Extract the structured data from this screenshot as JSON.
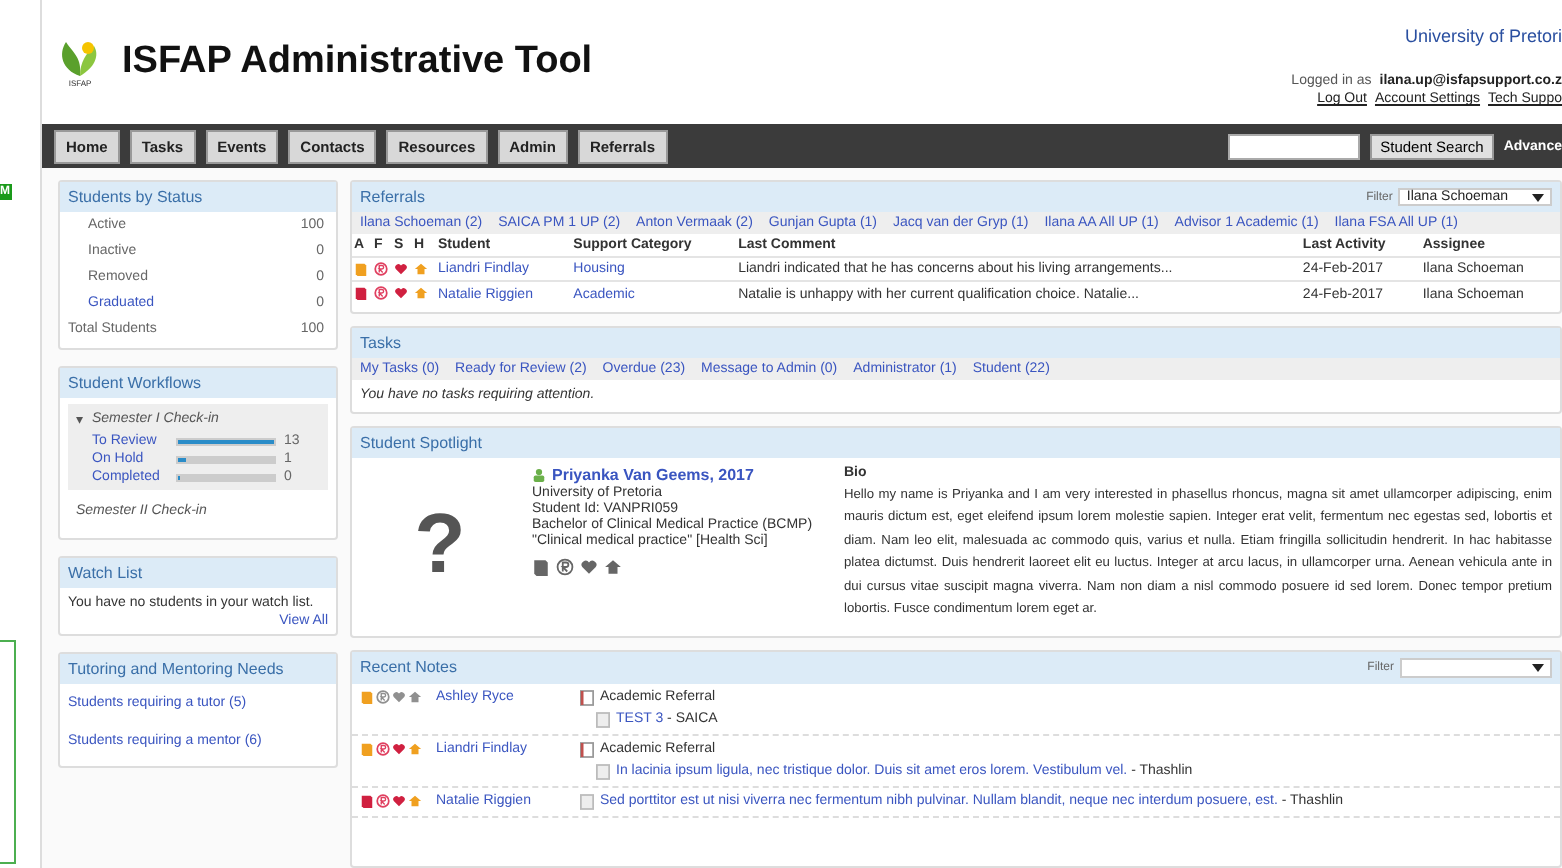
{
  "edge": {
    "badge": "M"
  },
  "header": {
    "logo_caption": "ISFAP",
    "title": "ISFAP Administrative Tool",
    "university": "University of Pretori",
    "logged_in_label": "Logged in as",
    "user": "ilana.up@isfapsupport.co.z",
    "links": [
      "Log Out",
      "Account Settings",
      "Tech Suppo"
    ]
  },
  "nav": {
    "tabs": [
      "Home",
      "Tasks",
      "Events",
      "Contacts",
      "Resources",
      "Admin",
      "Referrals"
    ],
    "search_button": "Student Search",
    "advanced": "Advance"
  },
  "students_by_status": {
    "title": "Students by Status",
    "rows": [
      {
        "label": "Active",
        "count": "100",
        "link": false
      },
      {
        "label": "Inactive",
        "count": "0",
        "link": false
      },
      {
        "label": "Removed",
        "count": "0",
        "link": false
      },
      {
        "label": "Graduated",
        "count": "0",
        "link": true
      }
    ],
    "total_label": "Total Students",
    "total": "100"
  },
  "workflows": {
    "title": "Student Workflows",
    "groups": [
      {
        "label": "Semester I Check-in",
        "expanded": true,
        "glyph": "▾",
        "items": [
          {
            "label": "To Review",
            "level": 1.0,
            "count": "13"
          },
          {
            "label": "On Hold",
            "level": 0.08,
            "count": "1"
          },
          {
            "label": "Completed",
            "level": 0,
            "count": "0"
          }
        ]
      },
      {
        "label": "Semester II Check-in",
        "expanded": false
      }
    ]
  },
  "watch_list": {
    "title": "Watch List",
    "message": "You have no students in your watch list.",
    "view_all": "View All"
  },
  "tutoring": {
    "title": "Tutoring and Mentoring Needs",
    "links": [
      "Students requiring a tutor (5)",
      "Students requiring a mentor (6)"
    ]
  },
  "referrals": {
    "title": "Referrals",
    "filter_label": "Filter",
    "filter_value": "Ilana Schoeman",
    "tabs": [
      "Ilana Schoeman (2)",
      "SAICA PM 1 UP (2)",
      "Anton Vermaak (2)",
      "Gunjan Gupta (1)",
      "Jacq van der Gryp (1)",
      "Ilana AA All UP (1)",
      "Advisor 1 Academic (1)",
      "Ilana FSA All UP (1)"
    ],
    "columns": [
      "A",
      "F",
      "S",
      "H",
      "Student",
      "Support Category",
      "Last Comment",
      "Last Activity",
      "Assignee"
    ],
    "rows": [
      {
        "icons": [
          {
            "kind": "book",
            "color": "#f0a020"
          },
          {
            "kind": "r",
            "color": "#e04060"
          },
          {
            "kind": "heart",
            "color": "#d02040"
          },
          {
            "kind": "home",
            "color": "#f0a020"
          }
        ],
        "student": "Liandri Findlay",
        "category": "Housing",
        "comment": "Liandri indicated that he has concerns about his living arrangements...",
        "date": "24-Feb-2017",
        "assignee": "Ilana Schoeman"
      },
      {
        "icons": [
          {
            "kind": "book",
            "color": "#d02040"
          },
          {
            "kind": "r",
            "color": "#e04060"
          },
          {
            "kind": "heart",
            "color": "#d02040"
          },
          {
            "kind": "home",
            "color": "#f0a020"
          }
        ],
        "student": "Natalie Riggien",
        "category": "Academic",
        "comment": "Natalie is unhappy with her current qualification choice. Natalie...",
        "date": "24-Feb-2017",
        "assignee": "Ilana Schoeman"
      }
    ]
  },
  "tasks": {
    "title": "Tasks",
    "tabs": [
      "My Tasks (0)",
      "Ready for Review (2)",
      "Overdue (23)",
      "Message to Admin (0)",
      "Administrator (1)",
      "Student (22)"
    ],
    "message": "You have no tasks requiring attention."
  },
  "spotlight": {
    "title": "Student Spotlight",
    "avatar_glyph": "?",
    "name": "Priyanka Van Geems, 2017",
    "lines": [
      "University of Pretoria",
      "Student Id: VANPRI059",
      "Bachelor of Clinical Medical Practice (BCMP)",
      "\"Clinical medical practice\" [Health Sci]"
    ],
    "bio_label": "Bio",
    "bio": "Hello my name is Priyanka and I am very interested in phasellus rhoncus, magna sit amet ullamcorper adipiscing, enim mauris dictum est, eget eleifend ipsum lorem molestie sapien. Integer erat velit, fermentum nec egestas sed, lobortis et diam. Nam leo elit, malesuada ac commodo quis, varius et nulla. Etiam fringilla sollicitudin hendrerit. In hac habitasse platea dictumst. Duis hendrerit laoreet elit eu luctus. Integer at arcu lacus, in ullamcorper urna. Aenean vehicula ante in dui cursus vitae suscipit magna viverra. Nam non diam a nisl commodo posuere id sed lorem. Donec tempor pretium lobortis. Fusce condimentum lorem eget ar."
  },
  "recent_notes": {
    "title": "Recent Notes",
    "filter_label": "Filter",
    "notes": [
      {
        "icons": [
          {
            "kind": "book",
            "color": "#f0a020"
          },
          {
            "kind": "r",
            "color": "#909090"
          },
          {
            "kind": "heart",
            "color": "#909090"
          },
          {
            "kind": "home",
            "color": "#909090"
          }
        ],
        "student": "Ashley Ryce",
        "type": "Academic Referral",
        "link": "TEST 3",
        "rest": " - SAICA"
      },
      {
        "icons": [
          {
            "kind": "book",
            "color": "#f0a020"
          },
          {
            "kind": "r",
            "color": "#e04060"
          },
          {
            "kind": "heart",
            "color": "#d02040"
          },
          {
            "kind": "home",
            "color": "#f0a020"
          }
        ],
        "student": "Liandri Findlay",
        "type": "Academic Referral",
        "link": "In lacinia ipsum ligula, nec tristique dolor. Duis sit amet eros lorem. Vestibulum vel.",
        "rest": " - Thashlin"
      },
      {
        "icons": [
          {
            "kind": "book",
            "color": "#d02040"
          },
          {
            "kind": "r",
            "color": "#e04060"
          },
          {
            "kind": "heart",
            "color": "#d02040"
          },
          {
            "kind": "home",
            "color": "#f0a020"
          }
        ],
        "student": "Natalie Riggien",
        "link": "Sed porttitor est ut nisi viverra nec fermentum nibh pulvinar. Nullam blandit, neque nec interdum posuere, est.",
        "rest": " - Thashlin"
      }
    ]
  }
}
